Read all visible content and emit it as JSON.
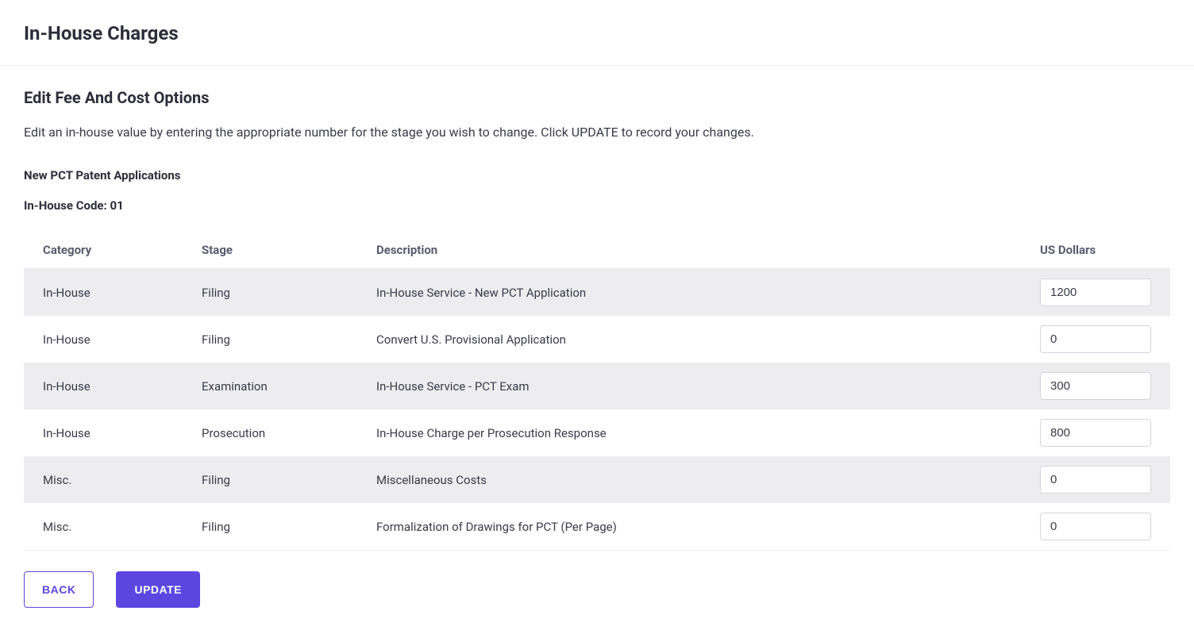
{
  "pageTitle": "In-House Charges",
  "sectionTitle": "Edit Fee And Cost Options",
  "instructions": "Edit an in-house value by entering the appropriate number for the stage you wish to change. Click UPDATE to record your changes.",
  "applicationTypeLabel": "New PCT Patent Applications",
  "codeLabel": "In-House Code: 01",
  "columns": {
    "category": "Category",
    "stage": "Stage",
    "description": "Description",
    "amount": "US Dollars"
  },
  "rows": [
    {
      "category": "In-House",
      "stage": "Filing",
      "description": "In-House Service - New PCT Application",
      "amount": "1200"
    },
    {
      "category": "In-House",
      "stage": "Filing",
      "description": "Convert U.S. Provisional Application",
      "amount": "0"
    },
    {
      "category": "In-House",
      "stage": "Examination",
      "description": "In-House Service - PCT Exam",
      "amount": "300"
    },
    {
      "category": "In-House",
      "stage": "Prosecution",
      "description": "In-House Charge per Prosecution Response",
      "amount": "800"
    },
    {
      "category": "Misc.",
      "stage": "Filing",
      "description": "Miscellaneous Costs",
      "amount": "0"
    },
    {
      "category": "Misc.",
      "stage": "Filing",
      "description": "Formalization of Drawings for PCT (Per Page)",
      "amount": "0"
    }
  ],
  "buttons": {
    "back": "BACK",
    "update": "UPDATE"
  }
}
